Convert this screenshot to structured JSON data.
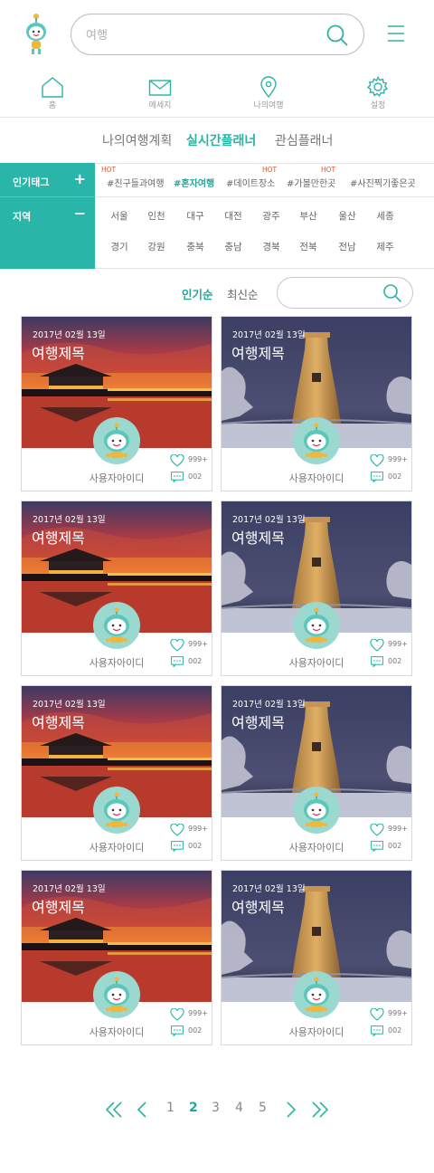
{
  "header": {
    "search_placeholder": "여행"
  },
  "nav": {
    "home": "홈",
    "message": "메세지",
    "my_trip": "나의여행",
    "settings": "설정"
  },
  "tabs": [
    "나의여행계획",
    "실시간플래너",
    "관심플래너"
  ],
  "filter": {
    "popular_tag_label": "인기태그",
    "region_label": "지역",
    "plus": "+",
    "minus": "−",
    "hot": "HOT",
    "tags": [
      "#친구들과여행",
      "#혼자여행",
      "#데이트장소",
      "#가볼만한곳",
      "#사진찍기좋은곳"
    ],
    "regions": [
      "서울",
      "인천",
      "대구",
      "대전",
      "광주",
      "부산",
      "울산",
      "세종",
      "경기",
      "강원",
      "충북",
      "충남",
      "경북",
      "전북",
      "전남",
      "제주"
    ]
  },
  "sort": {
    "popular": "인기순",
    "recent": "최신순"
  },
  "cards": [
    {
      "date": "2017년 02월 13일",
      "title": "여행제목",
      "user": "사용자아이디",
      "likes": "999+",
      "comments": "002"
    },
    {
      "date": "2017년 02월 13일",
      "title": "여행제목",
      "user": "사용자아이디",
      "likes": "999+",
      "comments": "002"
    },
    {
      "date": "2017년 02월 13일",
      "title": "여행제목",
      "user": "사용자아이디",
      "likes": "999+",
      "comments": "002"
    },
    {
      "date": "2017년 02월 13일",
      "title": "여행제목",
      "user": "사용자아이디",
      "likes": "999+",
      "comments": "002"
    },
    {
      "date": "2017년 02월 13일",
      "title": "여행제목",
      "user": "사용자아이디",
      "likes": "999+",
      "comments": "002"
    },
    {
      "date": "2017년 02월 13일",
      "title": "여행제목",
      "user": "사용자아이디",
      "likes": "999+",
      "comments": "002"
    },
    {
      "date": "2017년 02월 13일",
      "title": "여행제목",
      "user": "사용자아이디",
      "likes": "999+",
      "comments": "002"
    },
    {
      "date": "2017년 02월 13일",
      "title": "여행제목",
      "user": "사용자아이디",
      "likes": "999+",
      "comments": "002"
    }
  ],
  "pagination": {
    "pages": [
      "1",
      "2",
      "3",
      "4",
      "5"
    ],
    "current": "2"
  },
  "colors": {
    "accent": "#29b6a8",
    "hot": "#e0582b"
  },
  "icons": [
    "logo-mascot-icon",
    "search-icon",
    "menu-icon",
    "home-icon",
    "mail-icon",
    "location-pin-icon",
    "gear-icon",
    "heart-icon",
    "comment-icon",
    "first-page-icon",
    "prev-page-icon",
    "next-page-icon",
    "last-page-icon"
  ]
}
